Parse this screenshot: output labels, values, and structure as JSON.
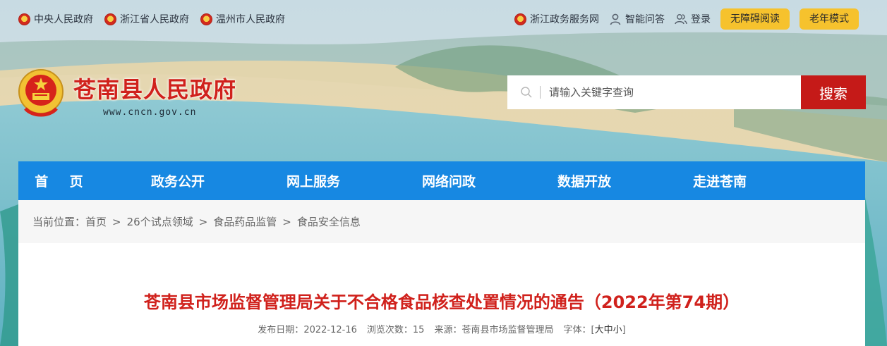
{
  "toplinks": {
    "left": [
      {
        "label": "中央人民政府"
      },
      {
        "label": "浙江省人民政府"
      },
      {
        "label": "温州市人民政府"
      }
    ],
    "service": "浙江政务服务网",
    "qa": "智能问答",
    "login": "登录",
    "accessible": "无障碍阅读",
    "elder": "老年模式"
  },
  "logo": {
    "title": "苍南县人民政府",
    "url": "www.cncn.gov.cn"
  },
  "search": {
    "placeholder": "请输入关键字查询",
    "button": "搜索"
  },
  "nav": [
    {
      "label": "首页"
    },
    {
      "label": "政务公开"
    },
    {
      "label": "网上服务"
    },
    {
      "label": "网络问政"
    },
    {
      "label": "数据开放"
    },
    {
      "label": "走进苍南"
    }
  ],
  "breadcrumb": {
    "prefix": "当前位置：",
    "items": [
      "首页",
      "26个试点领域",
      "食品药品监管",
      "食品安全信息"
    ],
    "separator": ">"
  },
  "article": {
    "title": "苍南县市场监督管理局关于不合格食品核查处置情况的通告（2022年第74期）",
    "date_label": "发布日期：",
    "date": "2022-12-16",
    "views_label": "浏览次数：",
    "views": "15",
    "source_label": "来源：",
    "source": "苍南县市场监督管理局",
    "font_label": "字体：",
    "font_open": "[",
    "font_big": "大",
    "font_mid": "中",
    "font_small": "小",
    "font_close": "]"
  },
  "colors": {
    "accent_red": "#d0211c",
    "nav_blue": "#1788e2",
    "pill_yellow": "#f6c22d",
    "search_red": "#c51a18"
  }
}
